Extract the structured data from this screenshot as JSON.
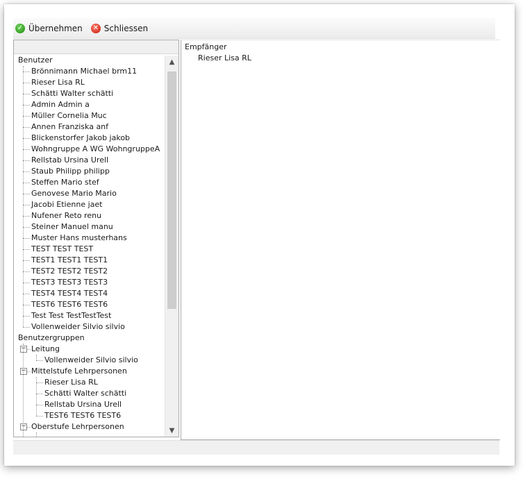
{
  "toolbar": {
    "apply_label": "Übernehmen",
    "close_label": "Schliessen"
  },
  "tree": {
    "users_group_label": "Benutzer",
    "users": [
      "Brönnimann Michael brm11",
      "Rieser Lisa RL",
      "Schätti Walter schätti",
      "Admin Admin a",
      "Müller Cornelia Muc",
      "Annen Franziska anf",
      "Blickenstorfer Jakob jakob",
      "Wohngruppe A WG WohngruppeA",
      "Rellstab Ursina Urell",
      "Staub Philipp philipp",
      "Steffen Mario stef",
      "Genovese Mario Mario",
      "Jacobi Etienne jaet",
      "Nufener Reto renu",
      "Steiner Manuel manu",
      "Muster Hans musterhans",
      "TEST TEST TEST",
      "TEST1 TEST1 TEST1",
      "TEST2 TEST2 TEST2",
      "TEST3 TEST3 TEST3",
      "TEST4 TEST4 TEST4",
      "TEST6 TEST6 TEST6",
      "Test Test TestTestTest",
      "Vollenweider Silvio silvio"
    ],
    "user_groups_label": "Benutzergruppen",
    "groups": [
      {
        "label": "Leitung",
        "members": [
          "Vollenweider Silvio silvio"
        ]
      },
      {
        "label": "Mittelstufe Lehrpersonen",
        "members": [
          "Rieser Lisa RL",
          "Schätti Walter schätti",
          "Rellstab Ursina Urell",
          "TEST6 TEST6 TEST6"
        ]
      },
      {
        "label": "Oberstufe Lehrpersonen",
        "members": []
      }
    ],
    "collapse_glyph": "−"
  },
  "recipients": {
    "title": "Empfänger",
    "items": [
      "Rieser Lisa RL"
    ]
  },
  "icons": {
    "apply": "check-circle-icon",
    "close": "cancel-circle-icon"
  },
  "colors": {
    "apply_icon": "#2a9a18",
    "close_icon": "#d62a1a"
  }
}
